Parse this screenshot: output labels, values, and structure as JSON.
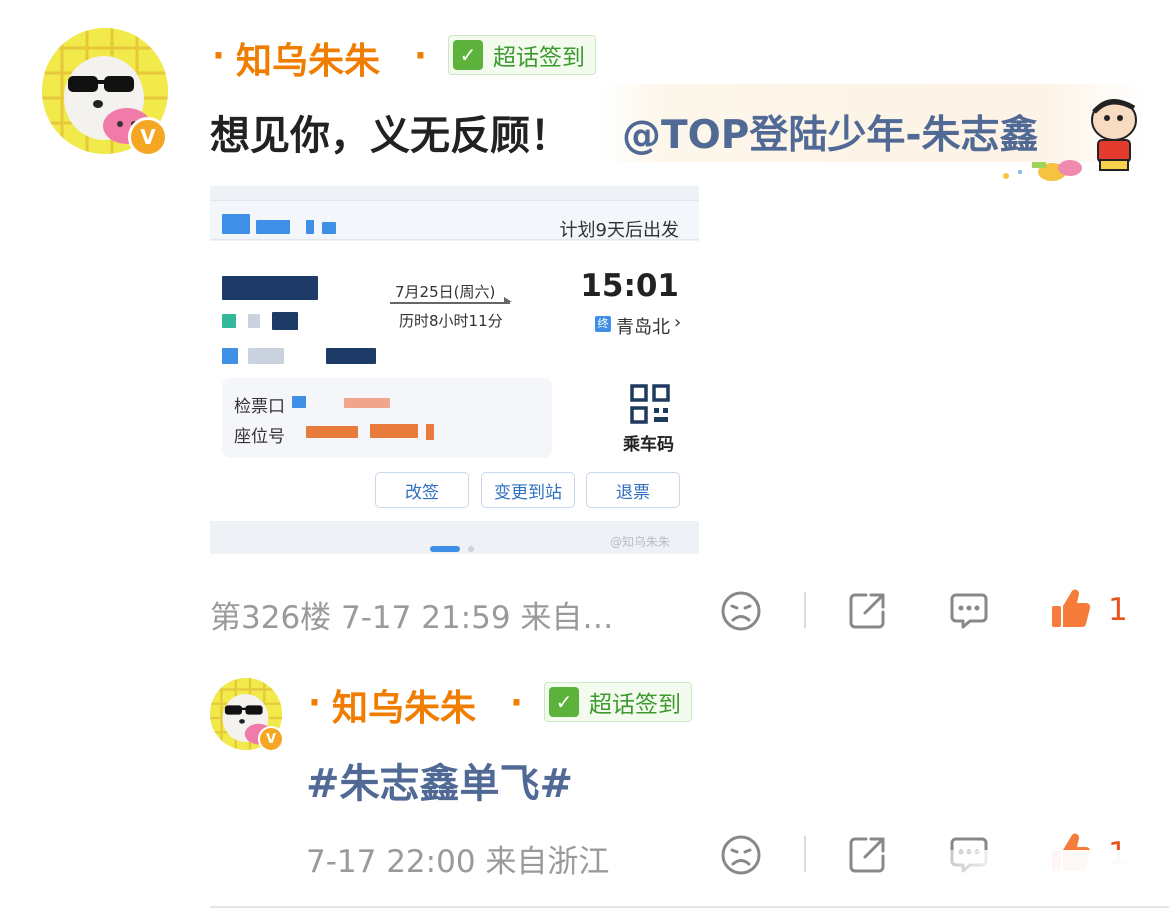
{
  "comment1": {
    "username": "知乌朱朱",
    "name_dot": "·",
    "checkin_badge": "超话签到",
    "text": "想见你，义无反顾！",
    "mention": "@TOP登陆少年-朱志鑫",
    "ticket": {
      "plan_text": "计划9天后出发",
      "date": "7月25日(周六)",
      "duration": "历时8小时11分",
      "arrive_time": "15:01",
      "end_tag": "终",
      "arrive_station": "青岛北",
      "arrive_chevron": "›",
      "gate_label": "检票口",
      "seat_label": "座位号",
      "qr_label": "乘车码",
      "buttons": [
        "改签",
        "变更到站",
        "退票"
      ],
      "watermark": "@知乌朱朱"
    },
    "meta": "第326楼  7-17 21:59  来自…",
    "like_count": "1"
  },
  "comment2": {
    "username": "知乌朱朱",
    "name_dot": "·",
    "checkin_badge": "超话签到",
    "hashtag": "#朱志鑫单飞#",
    "meta": "7-17 22:00  来自浙江",
    "like_count": "1"
  },
  "badge_symbol": "V",
  "check_symbol": "✓",
  "colors": {
    "username": "#f07c00",
    "link": "#506a95",
    "like": "#e8531f",
    "meta": "#9a9a9a",
    "checkin": "#3d9a2f"
  },
  "icons": [
    "sad-face-icon",
    "share-icon",
    "comment-icon",
    "thumbs-up-icon",
    "verified-icon",
    "checkin-icon",
    "qr-code-icon",
    "crayon-shin-chan-sticker-icon"
  ]
}
